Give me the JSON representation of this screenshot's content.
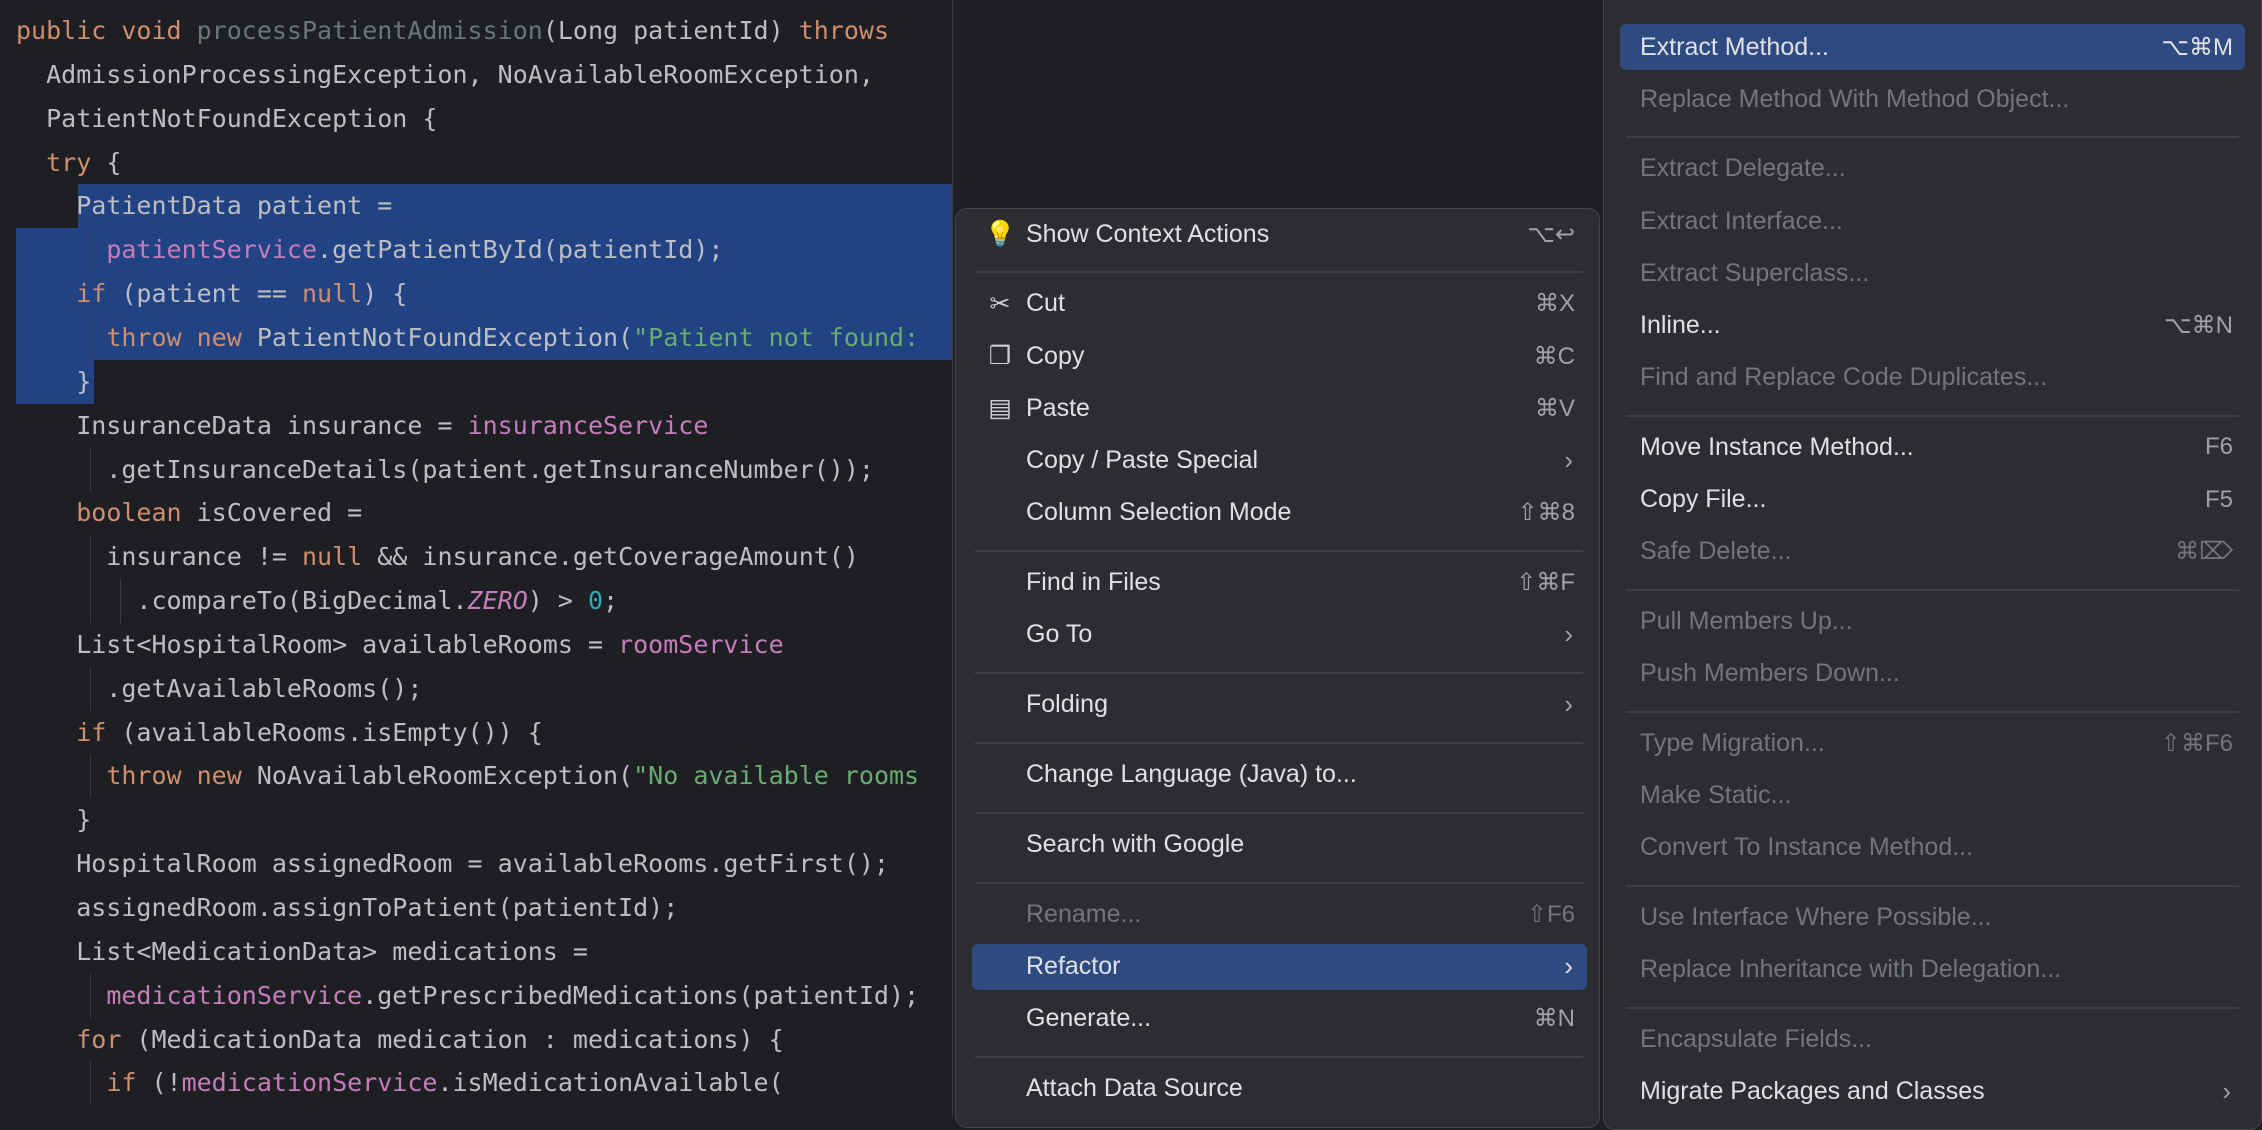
{
  "editor": {
    "lines": [
      {
        "tokens": [
          [
            "k",
            "public "
          ],
          [
            "k",
            "void "
          ],
          [
            "mg",
            "processPatientAdmission"
          ],
          [
            "p",
            "(Long patientId) "
          ],
          [
            "k",
            "throws"
          ]
        ]
      },
      {
        "tokens": [
          [
            "p",
            "  AdmissionProcessingException, NoAvailableRoomException,"
          ]
        ]
      },
      {
        "tokens": [
          [
            "p",
            "  PatientNotFoundException {"
          ]
        ]
      },
      {
        "tokens": [
          [
            "p",
            "  "
          ],
          [
            "k",
            "try"
          ],
          [
            "p",
            " {"
          ]
        ]
      },
      {
        "tokens": [
          [
            "p",
            "    PatientData patient ="
          ]
        ]
      },
      {
        "tokens": [
          [
            "p",
            "      "
          ],
          [
            "f",
            "patientService"
          ],
          [
            "p",
            ".getPatientById(patientId);"
          ]
        ]
      },
      {
        "tokens": [
          [
            "p",
            "    "
          ],
          [
            "k",
            "if"
          ],
          [
            "p",
            " (patient == "
          ],
          [
            "k",
            "null"
          ],
          [
            "p",
            ") {"
          ]
        ]
      },
      {
        "tokens": [
          [
            "p",
            "      "
          ],
          [
            "k",
            "throw new "
          ],
          [
            "p",
            "PatientNotFoundException("
          ],
          [
            "s",
            "\"Patient not found:"
          ]
        ]
      },
      {
        "tokens": [
          [
            "p",
            "    }"
          ]
        ]
      },
      {
        "tokens": [
          [
            "p",
            "    InsuranceData insurance = "
          ],
          [
            "f",
            "insuranceService"
          ]
        ]
      },
      {
        "tokens": [
          [
            "p",
            "      .getInsuranceDetails(patient.getInsuranceNumber());"
          ]
        ]
      },
      {
        "tokens": [
          [
            "p",
            "    "
          ],
          [
            "k",
            "boolean"
          ],
          [
            "p",
            " isCovered ="
          ]
        ]
      },
      {
        "tokens": [
          [
            "p",
            "      insurance != "
          ],
          [
            "k",
            "null"
          ],
          [
            "p",
            " && insurance.getCoverageAmount()"
          ]
        ]
      },
      {
        "tokens": [
          [
            "p",
            "        .compareTo(BigDecimal."
          ],
          [
            "i",
            "ZERO"
          ],
          [
            "p",
            ") > "
          ],
          [
            "n",
            "0"
          ],
          [
            "p",
            ";"
          ]
        ]
      },
      {
        "tokens": [
          [
            "p",
            "    List<HospitalRoom> availableRooms = "
          ],
          [
            "f",
            "roomService"
          ]
        ]
      },
      {
        "tokens": [
          [
            "p",
            "      .getAvailableRooms();"
          ]
        ]
      },
      {
        "tokens": [
          [
            "p",
            "    "
          ],
          [
            "k",
            "if"
          ],
          [
            "p",
            " (availableRooms.isEmpty()) {"
          ]
        ]
      },
      {
        "tokens": [
          [
            "p",
            "      "
          ],
          [
            "k",
            "throw new "
          ],
          [
            "p",
            "NoAvailableRoomException("
          ],
          [
            "s",
            "\"No available rooms"
          ]
        ]
      },
      {
        "tokens": [
          [
            "p",
            "    }"
          ]
        ]
      },
      {
        "tokens": [
          [
            "p",
            "    HospitalRoom assignedRoom = availableRooms.getFirst();"
          ]
        ]
      },
      {
        "tokens": [
          [
            "p",
            "    assignedRoom.assignToPatient(patientId);"
          ]
        ]
      },
      {
        "tokens": [
          [
            "p",
            "    List<MedicationData> medications ="
          ]
        ]
      },
      {
        "tokens": [
          [
            "p",
            "      "
          ],
          [
            "f",
            "medicationService"
          ],
          [
            "p",
            ".getPrescribedMedications(patientId);"
          ]
        ]
      },
      {
        "tokens": [
          [
            "p",
            "    "
          ],
          [
            "k",
            "for"
          ],
          [
            "p",
            " (MedicationData medication : medications) {"
          ]
        ]
      },
      {
        "tokens": [
          [
            "p",
            "      "
          ],
          [
            "k",
            "if"
          ],
          [
            "p",
            " (!"
          ],
          [
            "f",
            "medicationService"
          ],
          [
            "p",
            ".isMedicationAvailable("
          ]
        ]
      }
    ]
  },
  "context_menu": {
    "items": [
      {
        "icon": "lightbulb-icon",
        "glyph": "💡",
        "label": "Show Context Actions",
        "shortcut": "⌥↩"
      },
      {
        "sep": true
      },
      {
        "icon": "scissors-icon",
        "glyph": "✂",
        "label": "Cut",
        "shortcut": "⌘X"
      },
      {
        "icon": "copy-icon",
        "glyph": "❐",
        "label": "Copy",
        "shortcut": "⌘C"
      },
      {
        "icon": "clipboard-icon",
        "glyph": "▤",
        "label": "Paste",
        "shortcut": "⌘V"
      },
      {
        "label": "Copy / Paste Special",
        "submenu": true
      },
      {
        "label": "Column Selection Mode",
        "shortcut": "⇧⌘8"
      },
      {
        "sep": true
      },
      {
        "label": "Find in Files",
        "shortcut": "⇧⌘F"
      },
      {
        "label": "Go To",
        "submenu": true
      },
      {
        "sep": true
      },
      {
        "label": "Folding",
        "submenu": true
      },
      {
        "sep": true
      },
      {
        "label": "Change Language (Java) to..."
      },
      {
        "sep": true
      },
      {
        "label": "Search with Google"
      },
      {
        "sep": true
      },
      {
        "label": "Rename...",
        "shortcut": "⇧F6",
        "disabled": true
      },
      {
        "label": "Refactor",
        "submenu": true,
        "highlighted": true
      },
      {
        "label": "Generate...",
        "shortcut": "⌘N"
      },
      {
        "sep": true
      },
      {
        "label": "Attach Data Source"
      }
    ]
  },
  "refactor_menu": {
    "items": [
      {
        "label": "Extract Method...",
        "shortcut": "⌥⌘M",
        "highlighted": true
      },
      {
        "label": "Replace Method With Method Object...",
        "disabled": true
      },
      {
        "sep": true
      },
      {
        "label": "Extract Delegate...",
        "disabled": true
      },
      {
        "label": "Extract Interface...",
        "disabled": true
      },
      {
        "label": "Extract Superclass...",
        "disabled": true
      },
      {
        "label": "Inline...",
        "shortcut": "⌥⌘N"
      },
      {
        "label": "Find and Replace Code Duplicates...",
        "disabled": true
      },
      {
        "sep": true
      },
      {
        "label": "Move Instance Method...",
        "shortcut": "F6"
      },
      {
        "label": "Copy File...",
        "shortcut": "F5"
      },
      {
        "label": "Safe Delete...",
        "shortcut": "⌘⌦",
        "disabled": true
      },
      {
        "sep": true
      },
      {
        "label": "Pull Members Up...",
        "disabled": true
      },
      {
        "label": "Push Members Down...",
        "disabled": true
      },
      {
        "sep": true
      },
      {
        "label": "Type Migration...",
        "shortcut": "⇧⌘F6",
        "disabled": true
      },
      {
        "label": "Make Static...",
        "disabled": true
      },
      {
        "label": "Convert To Instance Method...",
        "disabled": true
      },
      {
        "sep": true
      },
      {
        "label": "Use Interface Where Possible...",
        "disabled": true
      },
      {
        "label": "Replace Inheritance with Delegation...",
        "disabled": true
      },
      {
        "sep": true
      },
      {
        "label": "Encapsulate Fields...",
        "disabled": true
      },
      {
        "label": "Migrate Packages and Classes",
        "submenu": true
      }
    ]
  }
}
